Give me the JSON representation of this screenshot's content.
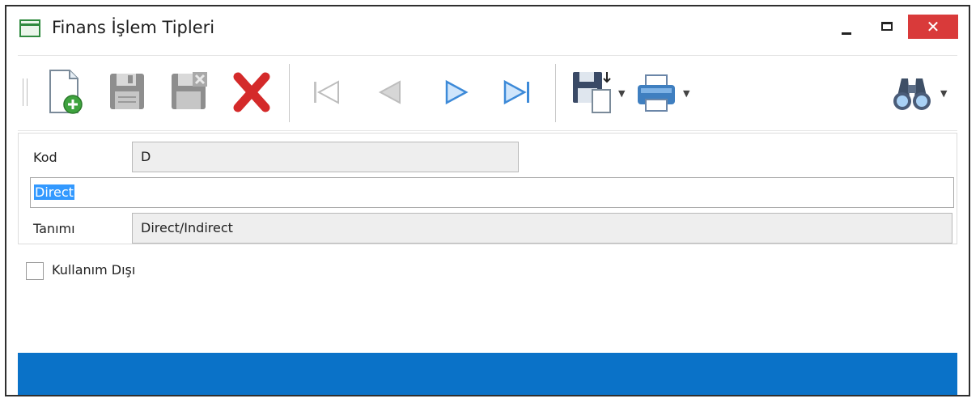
{
  "window": {
    "title": "Finans İşlem Tipleri",
    "close_glyph": "✕",
    "accent_color": "#0a72c8",
    "close_color": "#d93a3a"
  },
  "toolbar": {
    "buttons": [
      {
        "name": "new-record",
        "icon": "new-document-icon"
      },
      {
        "name": "save",
        "icon": "save-icon"
      },
      {
        "name": "save-close",
        "icon": "save-close-icon"
      },
      {
        "name": "delete",
        "icon": "delete-icon"
      },
      {
        "name": "first",
        "icon": "first-record-icon"
      },
      {
        "name": "previous",
        "icon": "previous-record-icon"
      },
      {
        "name": "next",
        "icon": "next-record-icon"
      },
      {
        "name": "last",
        "icon": "last-record-icon"
      },
      {
        "name": "export",
        "icon": "export-icon"
      },
      {
        "name": "print",
        "icon": "printer-icon"
      },
      {
        "name": "search",
        "icon": "binoculars-icon"
      }
    ]
  },
  "form": {
    "kod_label": "Kod",
    "kod_value": "D",
    "edit_value": "Direct",
    "tanim_label": "Tanımı",
    "tanim_value": "Direct/Indirect",
    "inactive_label": "Kullanım Dışı",
    "inactive_checked": false
  }
}
